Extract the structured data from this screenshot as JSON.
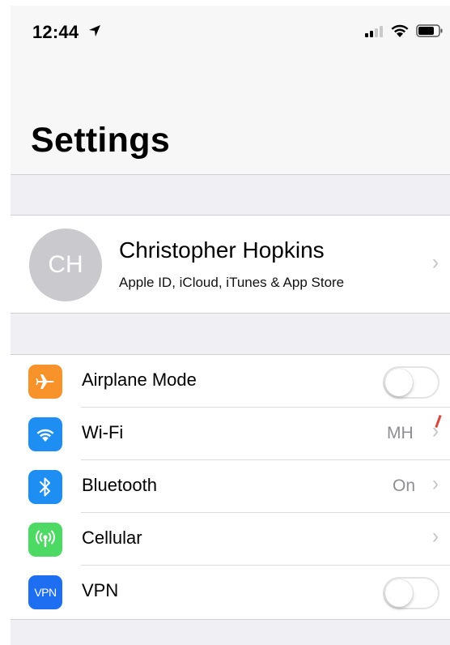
{
  "status_bar": {
    "time": "12:44",
    "location_icon": "location-arrow-icon",
    "signal_icon": "cellular-signal-icon",
    "wifi_icon": "wifi-icon",
    "battery_icon": "battery-icon"
  },
  "nav": {
    "title": "Settings"
  },
  "profile": {
    "initials": "CH",
    "name": "Christopher Hopkins",
    "subtitle": "Apple ID, iCloud, iTunes & App Store"
  },
  "connectivity": [
    {
      "label": "Airplane Mode",
      "icon": "airplane-icon",
      "icon_color": "#f7932a",
      "control": "toggle",
      "on": false
    },
    {
      "label": "Wi-Fi",
      "icon": "wifi-icon",
      "icon_color": "#1e8ef2",
      "value": "MH",
      "control": "chevron"
    },
    {
      "label": "Bluetooth",
      "icon": "bluetooth-icon",
      "icon_color": "#1e8ef2",
      "value": "On",
      "control": "chevron"
    },
    {
      "label": "Cellular",
      "icon": "cellular-antenna-icon",
      "icon_color": "#4cd964",
      "control": "chevron"
    },
    {
      "label": "VPN",
      "icon": "vpn-icon",
      "icon_color": "#1e6ef2",
      "icon_text": "VPN",
      "control": "toggle",
      "on": false
    }
  ],
  "colors": {
    "background": "#efeff4",
    "separator": "#d0d0d4",
    "secondary_text": "#8e8e93",
    "chevron": "#c4c4c8"
  }
}
